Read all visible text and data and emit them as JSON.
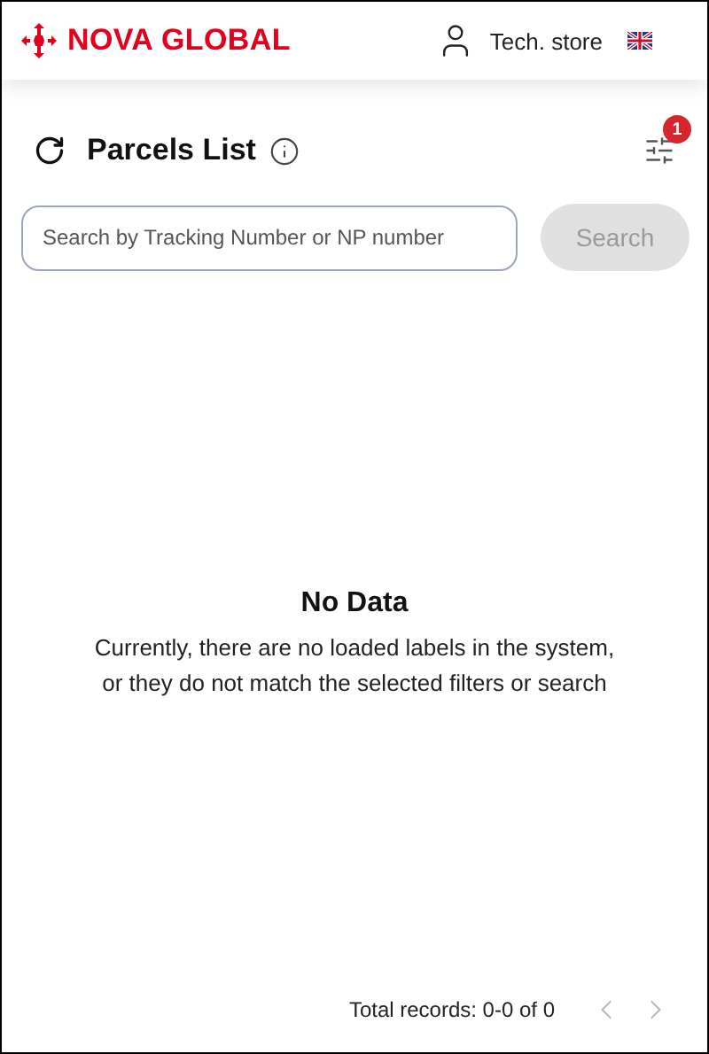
{
  "header": {
    "brand": "NOVA GLOBAL",
    "user": "Tech. store"
  },
  "title": "Parcels List",
  "filter_badge": "1",
  "search": {
    "placeholder": "Search by Tracking Number or NP number",
    "button": "Search",
    "disabled": true
  },
  "empty": {
    "title": "No Data",
    "lines": [
      "Currently, there are no loaded labels in the system,",
      "or they do not match the selected filters or search"
    ]
  },
  "footer": {
    "total": "Total records: 0-0 of 0",
    "prev_disabled": true,
    "next_disabled": true
  }
}
